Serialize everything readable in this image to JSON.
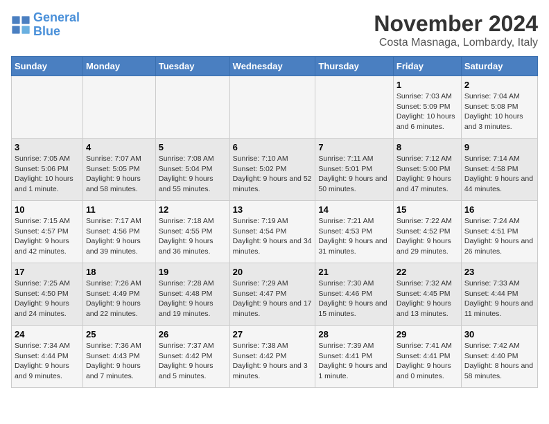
{
  "logo": {
    "line1": "General",
    "line2": "Blue"
  },
  "title": "November 2024",
  "subtitle": "Costa Masnaga, Lombardy, Italy",
  "days_of_week": [
    "Sunday",
    "Monday",
    "Tuesday",
    "Wednesday",
    "Thursday",
    "Friday",
    "Saturday"
  ],
  "weeks": [
    [
      {
        "day": "",
        "info": ""
      },
      {
        "day": "",
        "info": ""
      },
      {
        "day": "",
        "info": ""
      },
      {
        "day": "",
        "info": ""
      },
      {
        "day": "",
        "info": ""
      },
      {
        "day": "1",
        "info": "Sunrise: 7:03 AM\nSunset: 5:09 PM\nDaylight: 10 hours and 6 minutes."
      },
      {
        "day": "2",
        "info": "Sunrise: 7:04 AM\nSunset: 5:08 PM\nDaylight: 10 hours and 3 minutes."
      }
    ],
    [
      {
        "day": "3",
        "info": "Sunrise: 7:05 AM\nSunset: 5:06 PM\nDaylight: 10 hours and 1 minute."
      },
      {
        "day": "4",
        "info": "Sunrise: 7:07 AM\nSunset: 5:05 PM\nDaylight: 9 hours and 58 minutes."
      },
      {
        "day": "5",
        "info": "Sunrise: 7:08 AM\nSunset: 5:04 PM\nDaylight: 9 hours and 55 minutes."
      },
      {
        "day": "6",
        "info": "Sunrise: 7:10 AM\nSunset: 5:02 PM\nDaylight: 9 hours and 52 minutes."
      },
      {
        "day": "7",
        "info": "Sunrise: 7:11 AM\nSunset: 5:01 PM\nDaylight: 9 hours and 50 minutes."
      },
      {
        "day": "8",
        "info": "Sunrise: 7:12 AM\nSunset: 5:00 PM\nDaylight: 9 hours and 47 minutes."
      },
      {
        "day": "9",
        "info": "Sunrise: 7:14 AM\nSunset: 4:58 PM\nDaylight: 9 hours and 44 minutes."
      }
    ],
    [
      {
        "day": "10",
        "info": "Sunrise: 7:15 AM\nSunset: 4:57 PM\nDaylight: 9 hours and 42 minutes."
      },
      {
        "day": "11",
        "info": "Sunrise: 7:17 AM\nSunset: 4:56 PM\nDaylight: 9 hours and 39 minutes."
      },
      {
        "day": "12",
        "info": "Sunrise: 7:18 AM\nSunset: 4:55 PM\nDaylight: 9 hours and 36 minutes."
      },
      {
        "day": "13",
        "info": "Sunrise: 7:19 AM\nSunset: 4:54 PM\nDaylight: 9 hours and 34 minutes."
      },
      {
        "day": "14",
        "info": "Sunrise: 7:21 AM\nSunset: 4:53 PM\nDaylight: 9 hours and 31 minutes."
      },
      {
        "day": "15",
        "info": "Sunrise: 7:22 AM\nSunset: 4:52 PM\nDaylight: 9 hours and 29 minutes."
      },
      {
        "day": "16",
        "info": "Sunrise: 7:24 AM\nSunset: 4:51 PM\nDaylight: 9 hours and 26 minutes."
      }
    ],
    [
      {
        "day": "17",
        "info": "Sunrise: 7:25 AM\nSunset: 4:50 PM\nDaylight: 9 hours and 24 minutes."
      },
      {
        "day": "18",
        "info": "Sunrise: 7:26 AM\nSunset: 4:49 PM\nDaylight: 9 hours and 22 minutes."
      },
      {
        "day": "19",
        "info": "Sunrise: 7:28 AM\nSunset: 4:48 PM\nDaylight: 9 hours and 19 minutes."
      },
      {
        "day": "20",
        "info": "Sunrise: 7:29 AM\nSunset: 4:47 PM\nDaylight: 9 hours and 17 minutes."
      },
      {
        "day": "21",
        "info": "Sunrise: 7:30 AM\nSunset: 4:46 PM\nDaylight: 9 hours and 15 minutes."
      },
      {
        "day": "22",
        "info": "Sunrise: 7:32 AM\nSunset: 4:45 PM\nDaylight: 9 hours and 13 minutes."
      },
      {
        "day": "23",
        "info": "Sunrise: 7:33 AM\nSunset: 4:44 PM\nDaylight: 9 hours and 11 minutes."
      }
    ],
    [
      {
        "day": "24",
        "info": "Sunrise: 7:34 AM\nSunset: 4:44 PM\nDaylight: 9 hours and 9 minutes."
      },
      {
        "day": "25",
        "info": "Sunrise: 7:36 AM\nSunset: 4:43 PM\nDaylight: 9 hours and 7 minutes."
      },
      {
        "day": "26",
        "info": "Sunrise: 7:37 AM\nSunset: 4:42 PM\nDaylight: 9 hours and 5 minutes."
      },
      {
        "day": "27",
        "info": "Sunrise: 7:38 AM\nSunset: 4:42 PM\nDaylight: 9 hours and 3 minutes."
      },
      {
        "day": "28",
        "info": "Sunrise: 7:39 AM\nSunset: 4:41 PM\nDaylight: 9 hours and 1 minute."
      },
      {
        "day": "29",
        "info": "Sunrise: 7:41 AM\nSunset: 4:41 PM\nDaylight: 9 hours and 0 minutes."
      },
      {
        "day": "30",
        "info": "Sunrise: 7:42 AM\nSunset: 4:40 PM\nDaylight: 8 hours and 58 minutes."
      }
    ]
  ]
}
